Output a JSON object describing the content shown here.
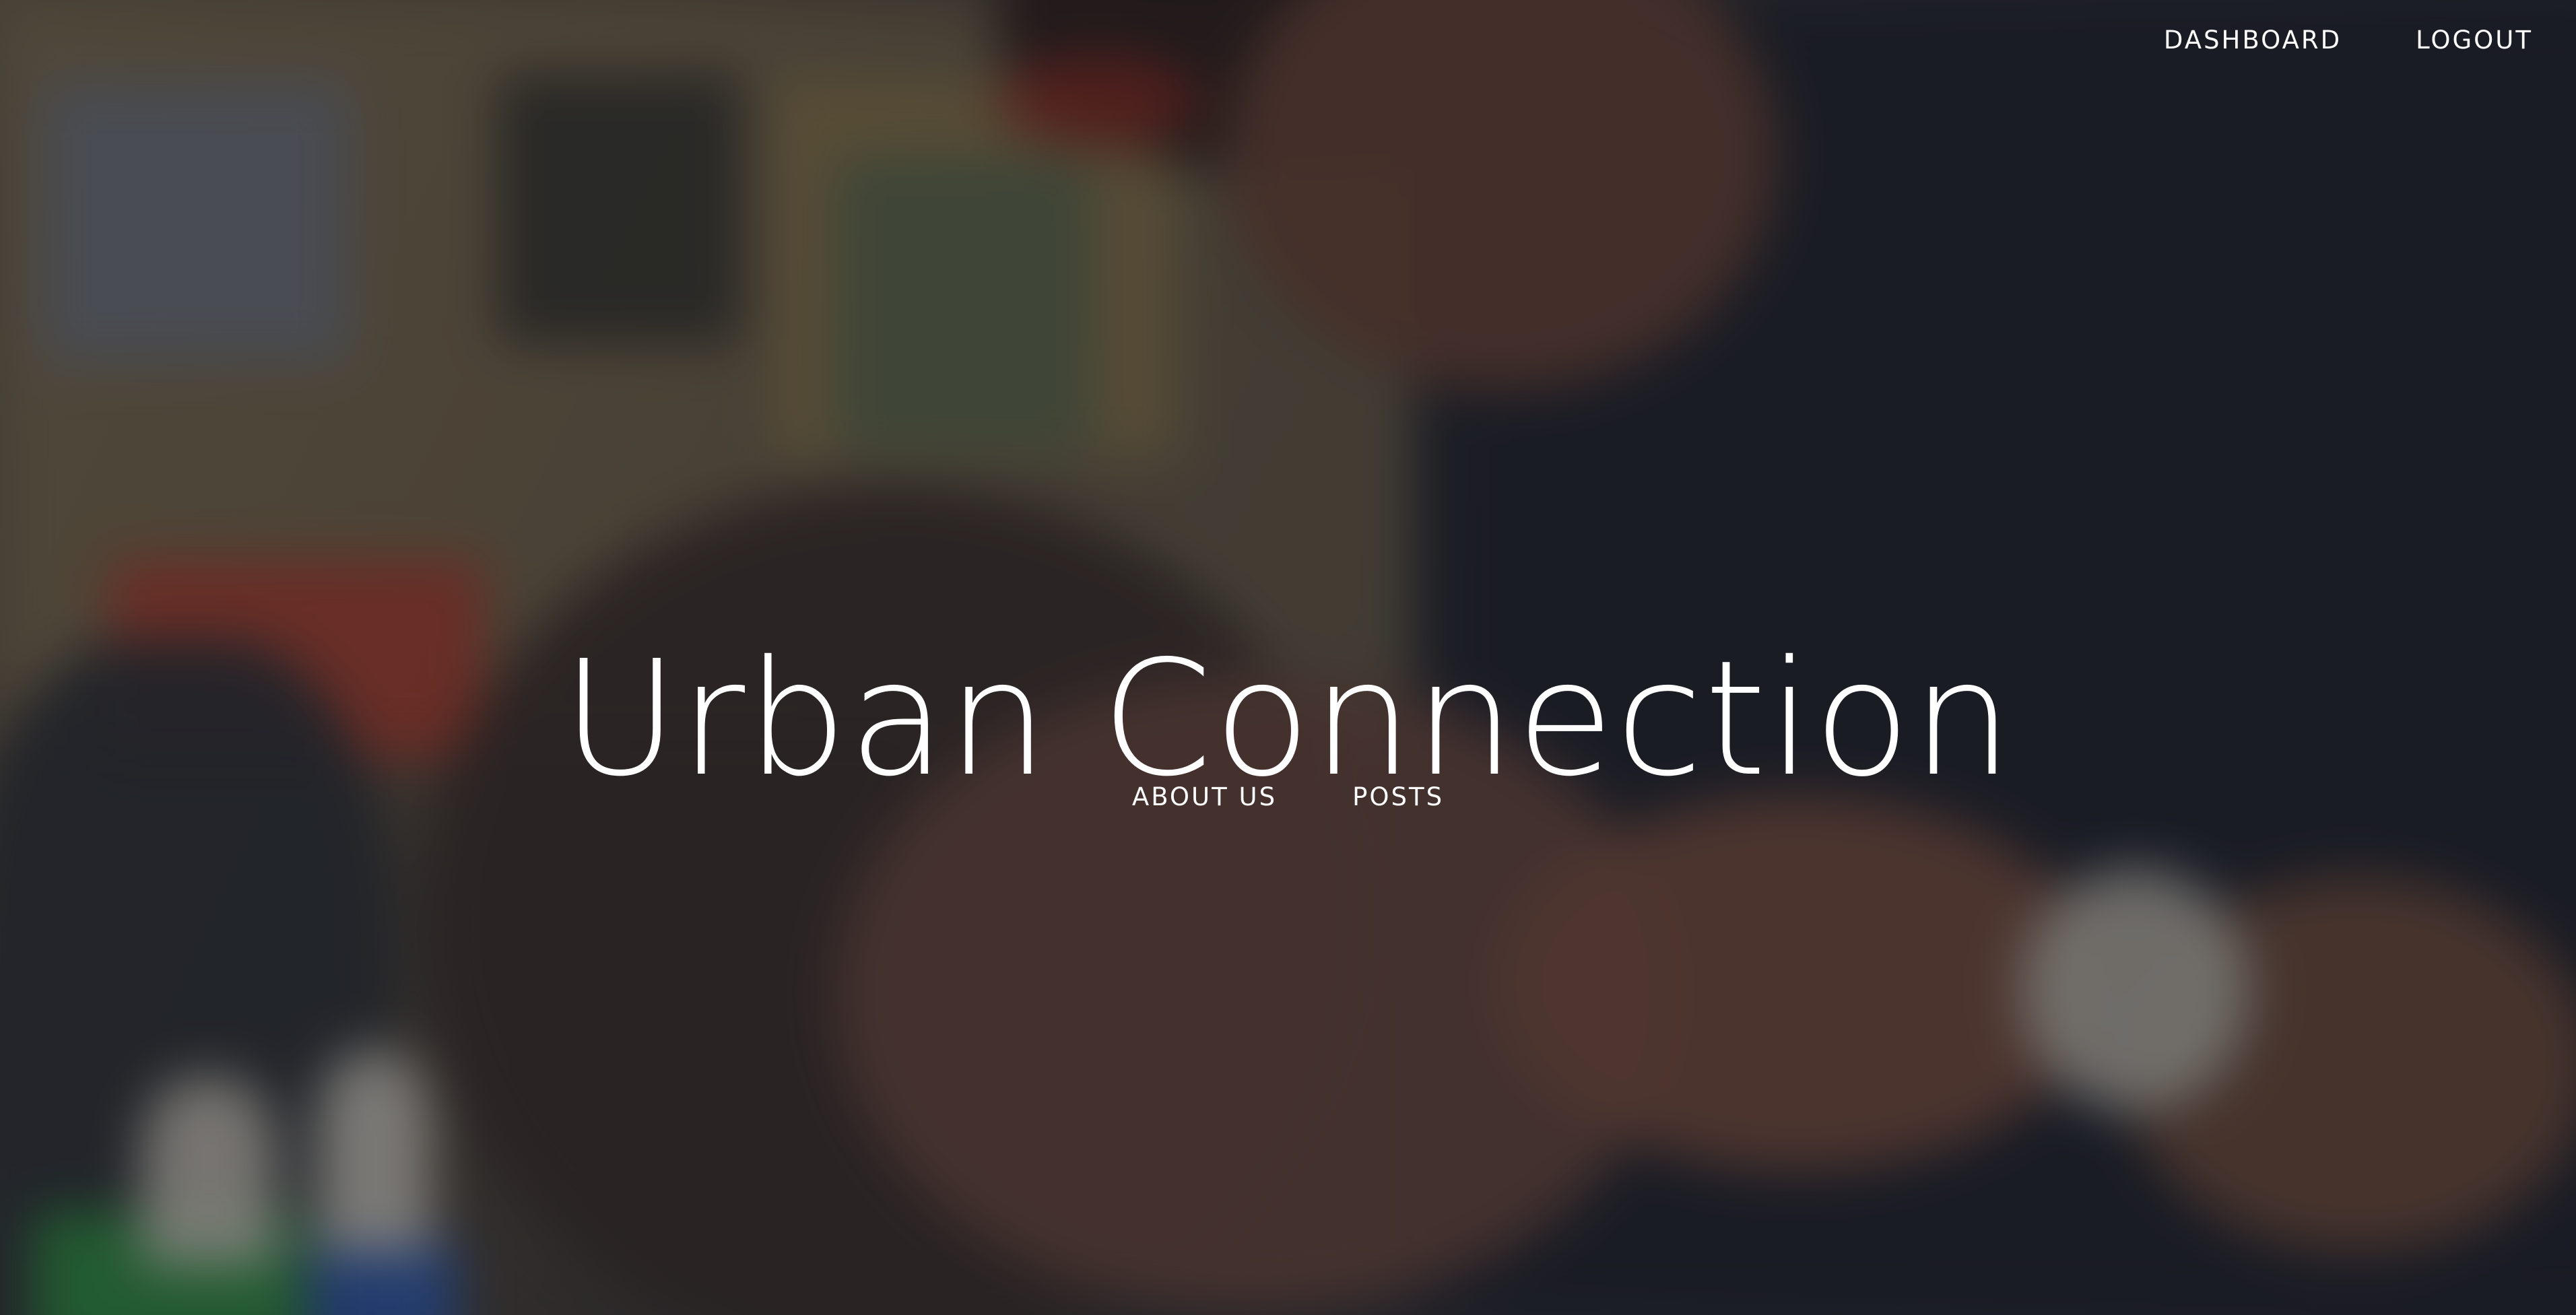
{
  "header": {
    "nav": [
      {
        "label": "DASHBOARD"
      },
      {
        "label": "LOGOUT"
      }
    ]
  },
  "hero": {
    "title": "Urban Connection",
    "background": "blurred barbershop photo, barber cutting a client's hair"
  },
  "sub_nav": [
    {
      "label": "ABOUT US"
    },
    {
      "label": "POSTS"
    }
  ],
  "colors": {
    "text": "#ffffff",
    "overlay": "rgba(20,20,24,0.42)"
  }
}
